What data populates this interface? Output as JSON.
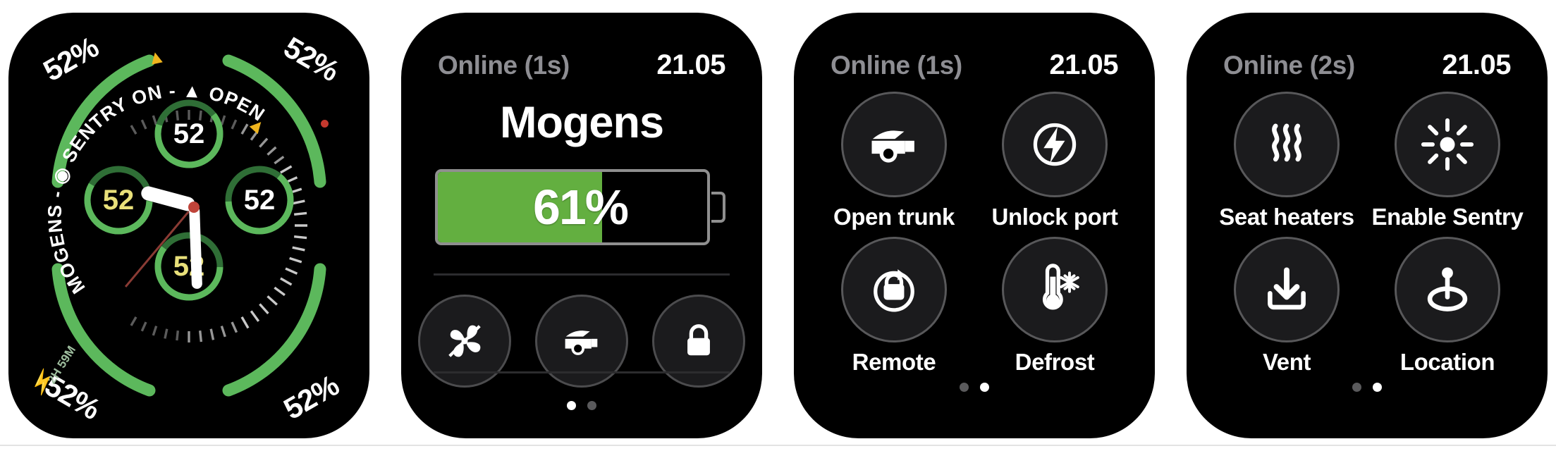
{
  "watch1": {
    "name": "tesla-watch-face",
    "corner_percents": [
      "52%",
      "52%",
      "52%",
      "52%"
    ],
    "curved_text": "MOGENS - ◉ SENTRY ON - ▲ OPEN",
    "curved_text_plain": "MOGENS - SENTRY ON - OPEN",
    "subdials": [
      {
        "value": "52",
        "color": "#ffffff",
        "position": "top"
      },
      {
        "value": "52",
        "color": "#e9e07a",
        "position": "left"
      },
      {
        "value": "52",
        "color": "#ffffff",
        "position": "right"
      },
      {
        "value": "52",
        "color": "#e9e07a",
        "position": "bottom"
      }
    ],
    "range_text": "2H 59M",
    "bolt_icon": "lightning-bolt-icon",
    "warning_icon": "warning-triangle-icon",
    "arc_color": "#5cb85c",
    "arc_track_color": "#2a6b2f"
  },
  "watch2": {
    "status": "Online (1s)",
    "time": "21.05",
    "car_name": "Mogens",
    "battery": {
      "percent_label": "61%",
      "percent_value": 61,
      "fill_color": "#63af40"
    },
    "buttons": [
      {
        "label": "Climate fan",
        "icon": "fan-icon"
      },
      {
        "label": "Open trunk",
        "icon": "trunk-icon"
      },
      {
        "label": "Lock",
        "icon": "lock-icon"
      }
    ],
    "page_dots": {
      "count": 2,
      "active": 0
    }
  },
  "watch3": {
    "status": "Online (1s)",
    "time": "21.05",
    "items": [
      {
        "label": "Open trunk",
        "icon": "trunk-icon"
      },
      {
        "label": "Unlock port",
        "icon": "charge-port-icon"
      },
      {
        "label": "Remote",
        "icon": "remote-start-icon"
      },
      {
        "label": "Defrost",
        "icon": "defrost-thermometer-icon"
      }
    ],
    "page_dots": {
      "count": 2,
      "active": 1
    }
  },
  "watch4": {
    "status": "Online (2s)",
    "time": "21.05",
    "items": [
      {
        "label": "Seat heaters",
        "icon": "seat-heater-waves-icon"
      },
      {
        "label": "Enable Sentry",
        "icon": "sentry-mode-icon"
      },
      {
        "label": "Vent",
        "icon": "vent-download-icon"
      },
      {
        "label": "Location",
        "icon": "location-pin-icon"
      }
    ],
    "page_dots": {
      "count": 2,
      "active": 1
    }
  }
}
